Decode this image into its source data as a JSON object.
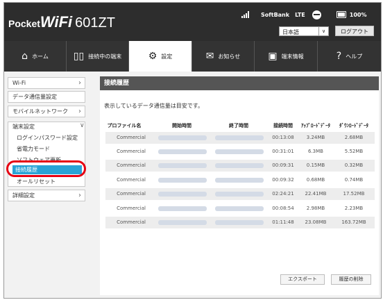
{
  "header": {
    "logo_prefix": "Pocket",
    "logo_brand": "WiFi",
    "model": "601ZT",
    "carrier": "SoftBank",
    "network": "LTE",
    "battery": "100%",
    "language": "日本語",
    "logout_label": "ログアウト"
  },
  "nav": {
    "tabs": [
      {
        "label": "ホーム",
        "icon": "home-icon"
      },
      {
        "label": "接続中の端末",
        "icon": "devices-icon"
      },
      {
        "label": "設定",
        "icon": "gear-icon"
      },
      {
        "label": "お知らせ",
        "icon": "mail-icon"
      },
      {
        "label": "端末情報",
        "icon": "info-icon"
      },
      {
        "label": "ヘルプ",
        "icon": "help-icon"
      }
    ],
    "active": "設定"
  },
  "sidebar": {
    "wifi": "Wi-Fi",
    "data_usage": "データ通信量設定",
    "mobile_network": "モバイルネットワーク",
    "device_settings": "端末設定",
    "login_password": "ログインパスワード設定",
    "power_saving": "省電力モード",
    "software_update": "ソフトウェア更新",
    "connection_history": "接続履歴",
    "reset_all": "オールリセット",
    "advanced": "詳細設定"
  },
  "main": {
    "title": "接続履歴",
    "note": "表示しているデータ通信量は目安です。",
    "columns": [
      "プロファイル名",
      "開始時間",
      "終了時間",
      "接続時間",
      "ｱｯﾌﾟﾛｰﾄﾞﾃﾞｰﾀ",
      "ﾀﾞｳﾝﾛｰﾄﾞﾃﾞｰﾀ"
    ],
    "rows": [
      {
        "profile": "Commercial",
        "duration": "00:13:08",
        "upload": "3.24MB",
        "download": "2.68MB"
      },
      {
        "profile": "Commercial",
        "duration": "00:31:01",
        "upload": "6.3MB",
        "download": "5.52MB"
      },
      {
        "profile": "Commercial",
        "duration": "00:09:31",
        "upload": "0.15MB",
        "download": "0.32MB"
      },
      {
        "profile": "Commercial",
        "duration": "00:09:32",
        "upload": "0.68MB",
        "download": "0.74MB"
      },
      {
        "profile": "Commercial",
        "duration": "02:24:21",
        "upload": "22.41MB",
        "download": "17.52MB"
      },
      {
        "profile": "Commercial",
        "duration": "00:08:54",
        "upload": "2.98MB",
        "download": "2.23MB"
      },
      {
        "profile": "Commercial",
        "duration": "01:11:48",
        "upload": "23.08MB",
        "download": "163.72MB"
      }
    ],
    "export_label": "エクスポート",
    "delete_label": "履歴の削除"
  }
}
